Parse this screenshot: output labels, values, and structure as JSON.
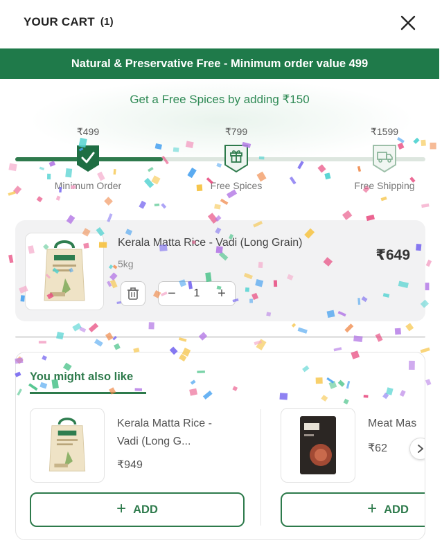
{
  "header": {
    "title": "YOUR CART",
    "count": "(1)"
  },
  "banner": {
    "text": "Natural & Preservative Free - Minimum order value 499"
  },
  "offer": {
    "message": "Get a Free Spices by adding ₹150",
    "progress_fraction": 0.36
  },
  "tiers": [
    {
      "price": "₹499",
      "label": "Minimum Order",
      "icon": "check-icon",
      "reached": true
    },
    {
      "price": "₹799",
      "label": "Free Spices",
      "icon": "gift-icon",
      "reached": false
    },
    {
      "price": "₹1599",
      "label": "Free Shipping",
      "icon": "truck-icon",
      "reached": false
    }
  ],
  "cart_item": {
    "name": "Kerala Matta Rice - Vadi (Long Grain)",
    "weight": "5kg",
    "price": "₹649",
    "quantity": "1",
    "decrement": "−",
    "increment": "+"
  },
  "recommendations": {
    "title": "You might also like",
    "items": [
      {
        "name_line1": "Kerala Matta Rice -",
        "name_line2": "Vadi (Long G...",
        "price": "₹949",
        "add_label": "ADD"
      },
      {
        "name_line1": "Meat Mas",
        "name_line2": "",
        "price": "₹62",
        "add_label": "ADD"
      }
    ]
  },
  "colors": {
    "brand_green": "#1f7a4a",
    "accent_green": "#2d7a4b",
    "card_bg": "#f2f2f3"
  }
}
